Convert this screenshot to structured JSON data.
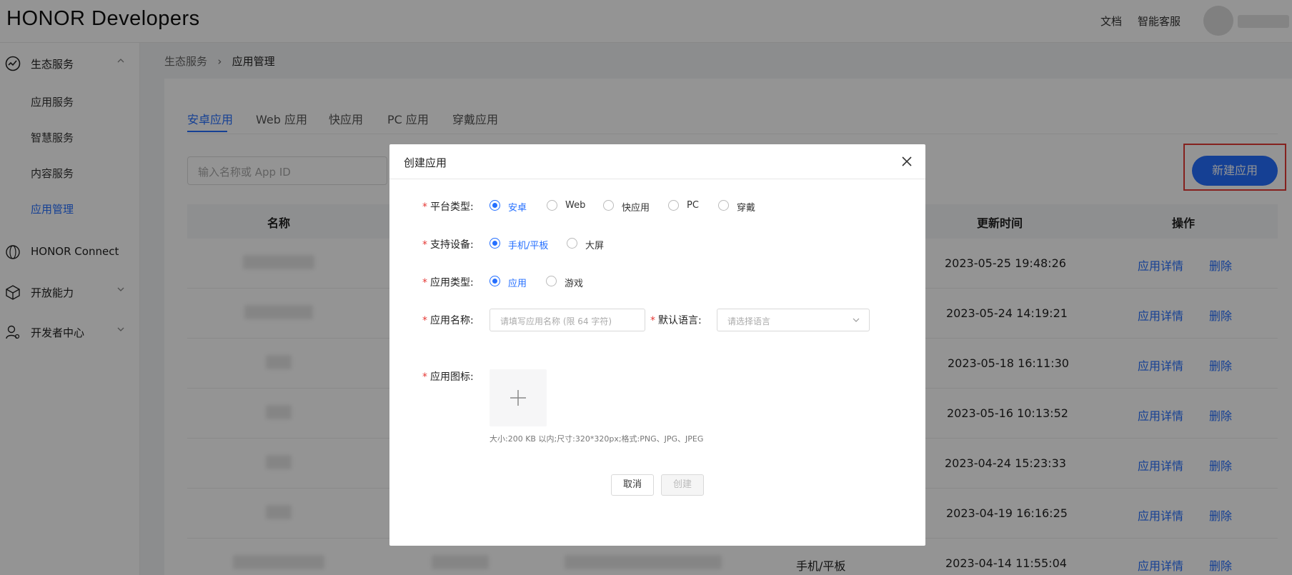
{
  "header": {
    "logo": "HONOR Developers",
    "links": [
      "文档",
      "智能客服"
    ]
  },
  "sidebar": {
    "group1": "生态服务",
    "items": [
      "应用服务",
      "智慧服务",
      "内容服务",
      "应用管理"
    ],
    "group2": "HONOR Connect",
    "group3": "开放能力",
    "group4": "开发者中心"
  },
  "breadcrumb": {
    "root": "生态服务",
    "current": "应用管理"
  },
  "tabs": [
    "安卓应用",
    "Web 应用",
    "快应用",
    "PC 应用",
    "穿戴应用"
  ],
  "search": {
    "placeholder": "输入名称或 App ID"
  },
  "new_button": "新建应用",
  "table": {
    "columns": [
      "名称",
      "更新时间",
      "操作"
    ],
    "rows": [
      {
        "updated": "2023-05-25 19:48:26",
        "detail": "应用详情",
        "delete": "删除"
      },
      {
        "updated": "2023-05-24 14:19:21",
        "detail": "应用详情",
        "delete": "删除"
      },
      {
        "updated": "2023-05-18 16:11:30",
        "detail": "应用详情",
        "delete": "删除"
      },
      {
        "updated": "2023-05-16 10:13:52",
        "detail": "应用详情",
        "delete": "删除"
      },
      {
        "updated": "2023-04-24 15:23:33",
        "detail": "应用详情",
        "delete": "删除"
      },
      {
        "updated": "2023-04-19 16:16:25",
        "detail": "应用详情",
        "delete": "删除"
      },
      {
        "device": "手机/平板",
        "updated": "2023-04-14 11:55:04",
        "detail": "应用详情",
        "delete": "删除"
      }
    ]
  },
  "modal": {
    "title": "创建应用",
    "platform": {
      "label": "平台类型:",
      "options": [
        "安卓",
        "Web",
        "快应用",
        "PC",
        "穿戴"
      ],
      "selected": "安卓"
    },
    "device": {
      "label": "支持设备:",
      "options": [
        "手机/平板",
        "大屏"
      ],
      "selected": "手机/平板"
    },
    "app_type": {
      "label": "应用类型:",
      "options": [
        "应用",
        "游戏"
      ],
      "selected": "应用"
    },
    "app_name": {
      "label": "应用名称:",
      "placeholder": "请填写应用名称 (限 64 字符)"
    },
    "language": {
      "label": "默认语言:",
      "placeholder": "请选择语言"
    },
    "icon": {
      "label": "应用图标:",
      "hint": "大小:200 KB 以内;尺寸:320*320px;格式:PNG、JPG、JPEG"
    },
    "cancel": "取消",
    "create": "创建"
  },
  "colors": {
    "accent": "#256fff",
    "highlight": "#e53935"
  }
}
